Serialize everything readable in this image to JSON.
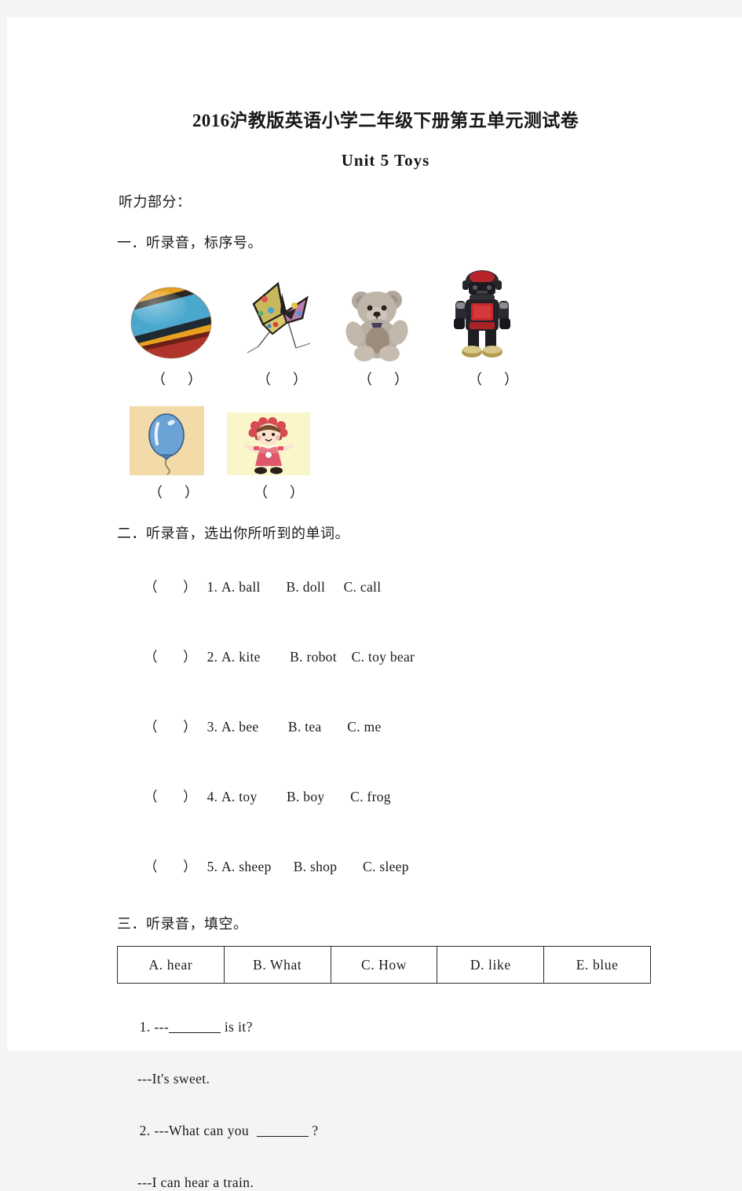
{
  "page": {
    "title": "2016沪教版英语小学二年级下册第五单元测试卷",
    "subtitle": "Unit 5 Toys",
    "listening_label": "听力部分："
  },
  "section_one": {
    "heading": "一．听录音，标序号。",
    "row1": [
      {
        "name": "ball",
        "bracket": "（    ）"
      },
      {
        "name": "kite",
        "bracket": "（    ）"
      },
      {
        "name": "toy bear",
        "bracket": "（    ）"
      },
      {
        "name": "robot",
        "bracket": "（    ）"
      }
    ],
    "row2": [
      {
        "name": "balloon",
        "bracket": "（    ）"
      },
      {
        "name": "doll",
        "bracket": "（    ）"
      }
    ]
  },
  "section_two": {
    "heading": "二．听录音，选出你所听到的单词。",
    "items": [
      {
        "paren": "（    ）",
        "num": "1.",
        "a": "A. ball",
        "b": "B. doll",
        "c": "C. call"
      },
      {
        "paren": "（    ）",
        "num": "2.",
        "a": "A. kite",
        "b": "B. robot",
        "c": "C. toy bear"
      },
      {
        "paren": "（    ）",
        "num": "3.",
        "a": "A. bee",
        "b": "B. tea",
        "c": "C. me"
      },
      {
        "paren": "（    ）",
        "num": "4.",
        "a": "A. toy",
        "b": "B. boy",
        "c": "C. frog"
      },
      {
        "paren": "（    ）",
        "num": "5.",
        "a": "A. sheep",
        "b": "B. shop",
        "c": "C. sleep"
      }
    ]
  },
  "section_three": {
    "heading": "三．听录音，填空。",
    "word_bank": [
      "A. hear",
      "B. What",
      "C. How",
      "D. like",
      "E. blue"
    ],
    "questions": [
      {
        "num": "1.",
        "before": "---",
        "after": " is it?",
        "answer_line": "---It's sweet."
      },
      {
        "num": "2.",
        "before": "---What can you  ",
        "after": " ?",
        "answer_line": "---I can hear a train."
      }
    ]
  },
  "colors": {
    "page_background": "#ffffff",
    "outer_margin": "#f4f4f4",
    "text": "#1a1a1a",
    "table_border": "#2a2a2a",
    "balloon_frame": "#f2dba8",
    "doll_frame": "#fbf6c9"
  }
}
